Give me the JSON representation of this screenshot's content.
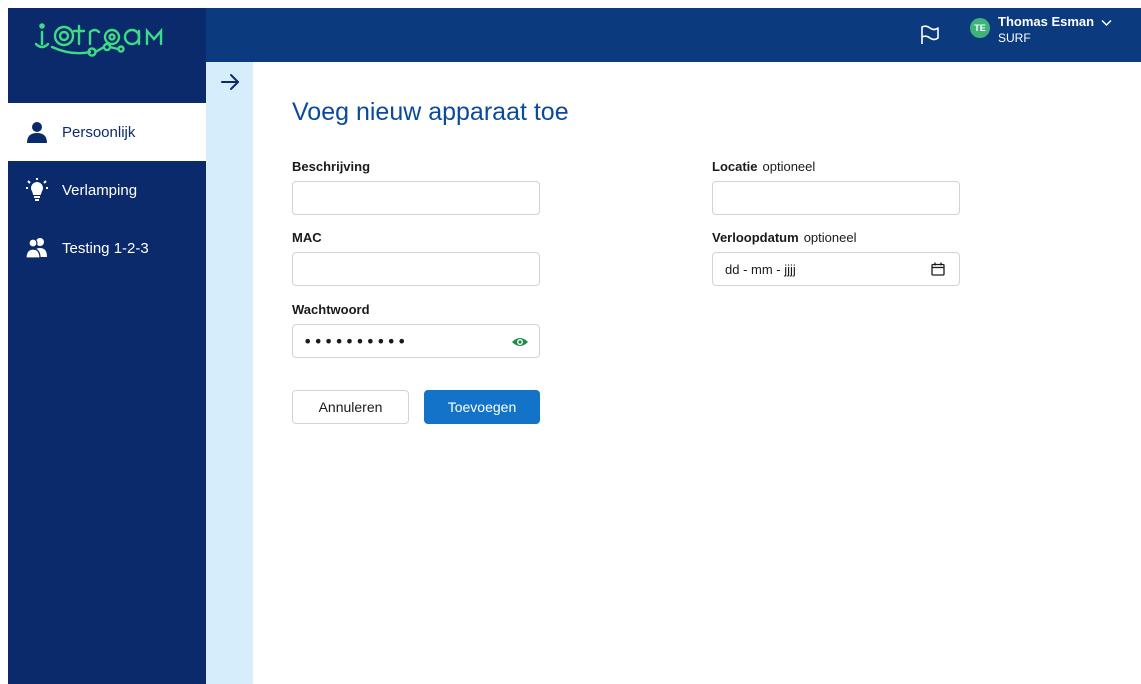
{
  "app": {
    "logo_text": "iotroam",
    "brand_color": "#0b2a6b",
    "accent_color": "#1273c9",
    "logo_color": "#3ddc84"
  },
  "sidebar": {
    "items": [
      {
        "label": "Persoonlijk",
        "icon": "person-icon",
        "active": true
      },
      {
        "label": "Verlamping",
        "icon": "lightbulb-icon",
        "active": false
      },
      {
        "label": "Testing 1-2-3",
        "icon": "group-icon",
        "active": false
      }
    ]
  },
  "header": {
    "user_initials": "TE",
    "user_name": "Thomas Esman",
    "user_org": "SURF"
  },
  "form": {
    "title": "Voeg nieuw apparaat toe",
    "description_label": "Beschrijving",
    "description_value": "",
    "mac_label": "MAC",
    "mac_value": "",
    "password_label": "Wachtwoord",
    "password_masked": "••••••••••",
    "location_label": "Locatie",
    "location_optional": "optioneel",
    "location_value": "",
    "expiry_label": "Verloopdatum",
    "expiry_optional": "optioneel",
    "expiry_placeholder": "dd - mm - jjjj",
    "cancel_label": "Annuleren",
    "submit_label": "Toevoegen"
  }
}
